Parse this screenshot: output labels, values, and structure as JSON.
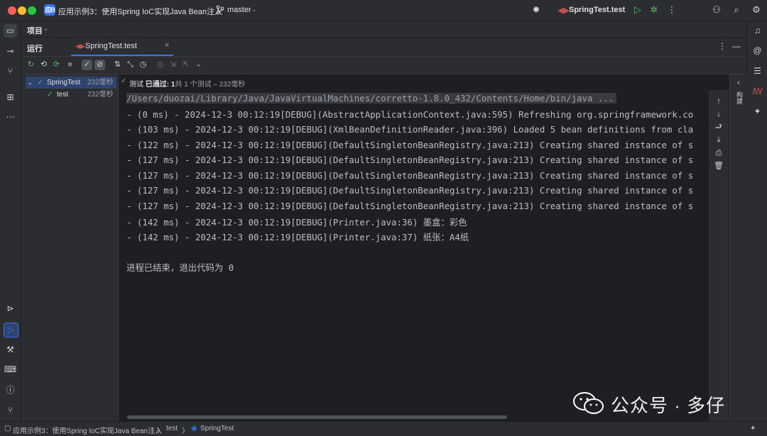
{
  "titlebar": {
    "project_badge": "应B",
    "project_title": "应用示例3：使用Spring IoC实现Java Bean注入",
    "branch": "master",
    "run_config": "SpringTest.test"
  },
  "panel": {
    "project_label": "项目",
    "run_label": "运行",
    "tab_label": "SpringTest.test"
  },
  "tree": {
    "items": [
      {
        "name": "SpringTest",
        "time": "232毫秒"
      },
      {
        "name": "test",
        "time": "232毫秒"
      }
    ]
  },
  "status": {
    "prefix": "测试 ",
    "passed": "已通过: 1",
    "detail": "共 1 个测试 – 232毫秒"
  },
  "console": {
    "command": "/Users/duozai/Library/Java/JavaVirtualMachines/corretto-1.8.0_432/Contents/Home/bin/java ...",
    "lines": [
      "- (0 ms) - 2024-12-3 00:12:19[DEBUG](AbstractApplicationContext.java:595) Refreshing org.springframework.co",
      "- (103 ms) - 2024-12-3 00:12:19[DEBUG](XmlBeanDefinitionReader.java:396) Loaded 5 bean definitions from cla",
      "- (122 ms) - 2024-12-3 00:12:19[DEBUG](DefaultSingletonBeanRegistry.java:213) Creating shared instance of s",
      "- (127 ms) - 2024-12-3 00:12:19[DEBUG](DefaultSingletonBeanRegistry.java:213) Creating shared instance of s",
      "- (127 ms) - 2024-12-3 00:12:19[DEBUG](DefaultSingletonBeanRegistry.java:213) Creating shared instance of s",
      "- (127 ms) - 2024-12-3 00:12:19[DEBUG](DefaultSingletonBeanRegistry.java:213) Creating shared instance of s",
      "- (127 ms) - 2024-12-3 00:12:19[DEBUG](DefaultSingletonBeanRegistry.java:213) Creating shared instance of s",
      "- (142 ms) - 2024-12-3 00:12:19[DEBUG](Printer.java:36) 墨盒：彩色",
      "- (142 ms) - 2024-12-3 00:12:19[DEBUG](Printer.java:37) 纸张：A4纸"
    ],
    "exit_text": "进程已结束，退出代码为",
    "exit_code": "0"
  },
  "side_panel_label": "构建",
  "statusbar": {
    "crumb_project": "应用示例3：使用Spring IoC实现Java Bean注入",
    "crumb_folder": "test",
    "crumb_class": "SpringTest",
    "separator": "〉"
  },
  "watermark": "公众号 · 多仔",
  "colors": {
    "accent": "#3574f0",
    "success": "#5fb865",
    "background": "#1e1f22",
    "panel": "#2b2d30"
  }
}
